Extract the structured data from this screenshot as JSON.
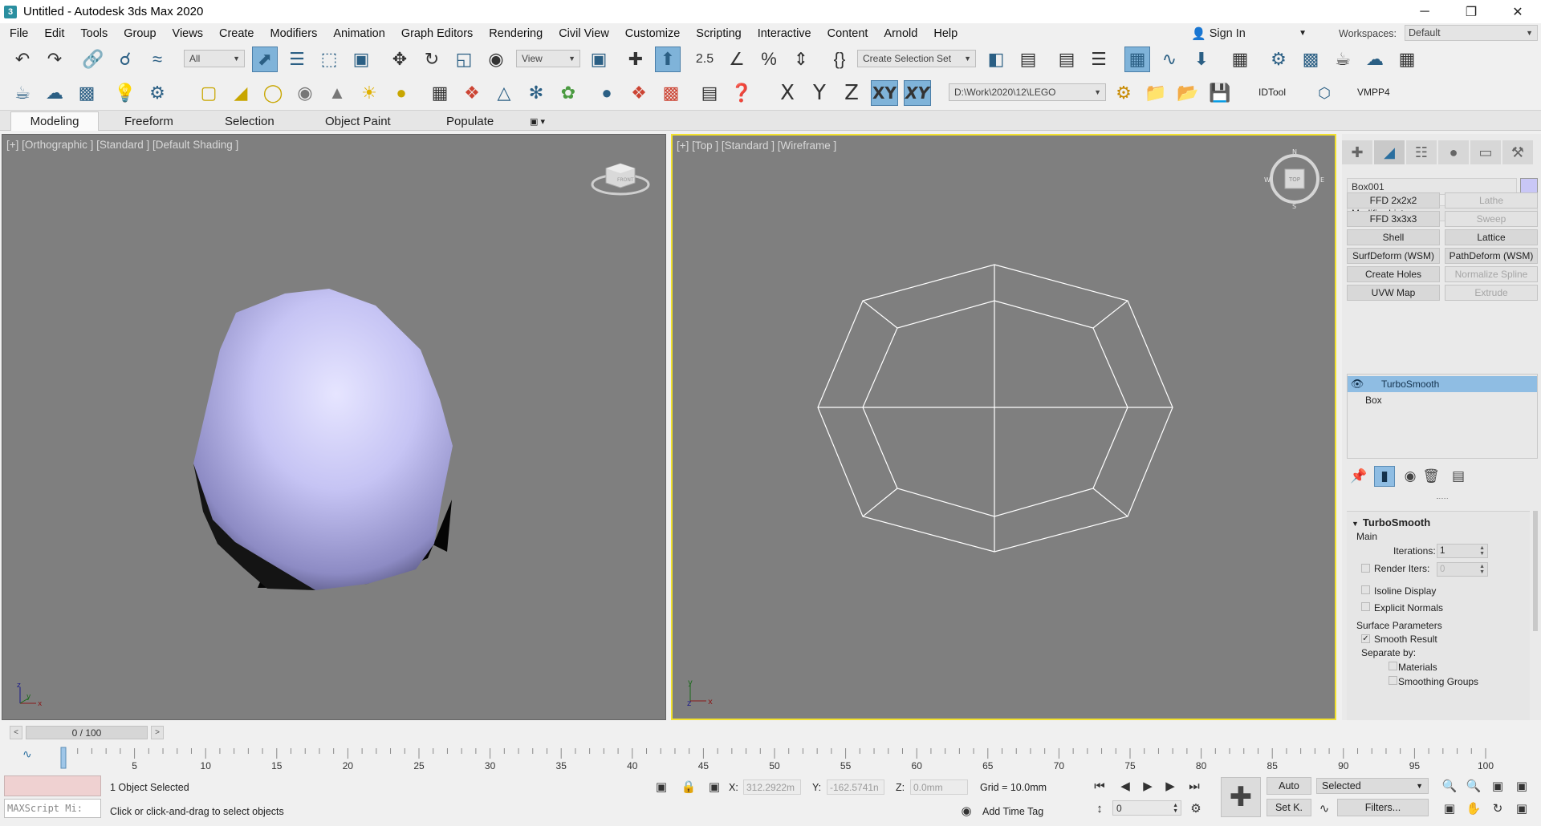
{
  "window": {
    "app_icon": "3",
    "title": "Untitled - Autodesk 3ds Max 2020",
    "minimize": "─",
    "maximize": "❐",
    "close": "✕"
  },
  "menu": {
    "items": [
      "File",
      "Edit",
      "Tools",
      "Group",
      "Views",
      "Create",
      "Modifiers",
      "Animation",
      "Graph Editors",
      "Rendering",
      "Civil View",
      "Customize",
      "Scripting",
      "Interactive",
      "Content",
      "Arnold",
      "Help"
    ],
    "sign_in": "Sign In",
    "workspaces_label": "Workspaces:",
    "workspace_value": "Default"
  },
  "toolbar1": {
    "selection_filter": "All",
    "ref_coord": "View",
    "snap_label": "2.5",
    "named_selection": "Create Selection Set"
  },
  "toolbar2": {
    "axis_x": "X",
    "axis_y": "Y",
    "axis_z": "Z",
    "axis_xy": "XY",
    "axis_xy2": "XY",
    "project_path": "D:\\Work\\2020\\12\\LEGO",
    "idtool": "IDTool",
    "vmpp4": "VMPP4"
  },
  "ribbon": {
    "tabs": [
      "Modeling",
      "Freeform",
      "Selection",
      "Object Paint",
      "Populate"
    ],
    "active": "Modeling"
  },
  "viewports": {
    "left_label": "[+] [Orthographic ] [Standard ] [Default Shading ]",
    "right_label": "[+] [Top ] [Standard ] [Wireframe ]",
    "viewcube_front": "FRONT",
    "viewcube_top": "TOP",
    "compass_n": "N",
    "compass_s": "S",
    "compass_w": "W",
    "compass_e": "E",
    "axis_x": "x",
    "axis_y": "y",
    "axis_z": "z",
    "shaded_color": "#c9c7f6",
    "wire_color": "#ffffff"
  },
  "command_panel": {
    "object_name": "Box001",
    "object_color": "#c9c7f6",
    "modifier_list": "Modifier List",
    "modifier_buttons": [
      {
        "label": "FFD 2x2x2",
        "enabled": true
      },
      {
        "label": "Lathe",
        "enabled": false
      },
      {
        "label": "FFD 3x3x3",
        "enabled": true
      },
      {
        "label": "Sweep",
        "enabled": false
      },
      {
        "label": "Shell",
        "enabled": true
      },
      {
        "label": "Lattice",
        "enabled": true
      },
      {
        "label": "SurfDeform (WSM)",
        "enabled": true
      },
      {
        "label": "PathDeform (WSM)",
        "enabled": true
      },
      {
        "label": "Create Holes",
        "enabled": true
      },
      {
        "label": "Normalize Spline",
        "enabled": false
      },
      {
        "label": "UVW Map",
        "enabled": true
      },
      {
        "label": "Extrude",
        "enabled": false
      }
    ],
    "stack": [
      "TurboSmooth",
      "Box"
    ],
    "rollout": {
      "title": "TurboSmooth",
      "main": "Main",
      "iterations_label": "Iterations:",
      "iterations_value": "1",
      "render_iters_label": "Render Iters:",
      "render_iters_value": "0",
      "isoline": "Isoline Display",
      "explicit": "Explicit Normals",
      "surface": "Surface Parameters",
      "smooth_result": "Smooth Result",
      "smooth_check": "✓",
      "separate": "Separate by:",
      "materials": "Materials",
      "smoothing_groups": "Smoothing Groups"
    }
  },
  "timeline": {
    "frame_display": "0 / 100",
    "prev": "<",
    "next": ">",
    "ticks": [
      "0",
      "5",
      "10",
      "15",
      "20",
      "25",
      "30",
      "35",
      "40",
      "45",
      "50",
      "55",
      "60",
      "65",
      "70",
      "75",
      "80",
      "85",
      "90",
      "95",
      "100"
    ]
  },
  "status": {
    "maxscript_placeholder": "MAXScript Mi:",
    "objects_selected": "1 Object Selected",
    "prompt": "Click or click-and-drag to select objects",
    "x_label": "X:",
    "x_value": "312.2922m",
    "y_label": "Y:",
    "y_value": "-162.5741n",
    "z_label": "Z:",
    "z_value": "0.0mm",
    "grid": "Grid = 10.0mm",
    "add_time_tag": "Add Time Tag",
    "auto": "Auto",
    "set_key": "Set K.",
    "selected": "Selected",
    "filters": "Filters...",
    "frame_value": "0"
  }
}
